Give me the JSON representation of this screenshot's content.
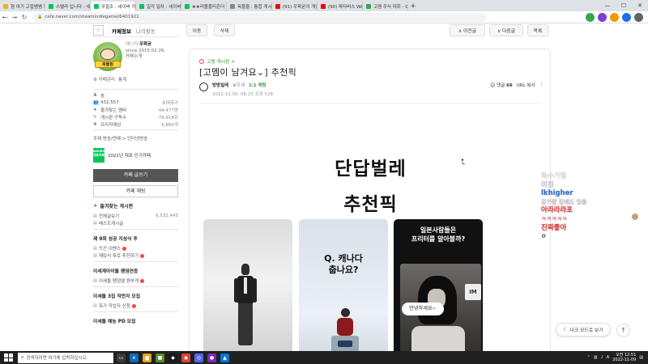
{
  "browser": {
    "tabs": [
      {
        "label": "형 여기 고컬쌤쌤 목블림",
        "color": "#f4b400"
      },
      {
        "label": "스텔라 입니다 : 네이버 카페",
        "color": "#03c75a"
      },
      {
        "label": "우질조 : 네이버 카페",
        "color": "#03c75a"
      },
      {
        "label": "일각 일차 : 네이버 카페",
        "color": "#03c75a"
      },
      {
        "label": "★★러블블리즌더 고려합",
        "color": "#03c75a"
      },
      {
        "label": "옥블블 : 통합 게시판 소개",
        "color": "#888888"
      },
      {
        "label": "(91) 우왁굳의 게임 - YouTube",
        "color": "#ff0000"
      },
      {
        "label": "(90) 왁타버스 WAKTAVERSE",
        "color": "#ff0000"
      },
      {
        "label": "고멤 주식 대회 - Google",
        "color": "#34a853"
      }
    ],
    "active_tab": 2,
    "new_tab": "+",
    "url": "cafe.naver.com/steamindiegame/6401921"
  },
  "sidebar": {
    "tab_info": "카페정보",
    "tab_activity": "나의활동",
    "logo_text": "왁물원",
    "manager_label": "매니저",
    "manager_name": "우왁굳",
    "since": "since 2015.02.26.",
    "cafe_intro": "카페소개",
    "links": [
      "⚙ 카페관리",
      "통계"
    ],
    "level": "숲",
    "members": "432,557",
    "invite": "초대하기",
    "stats": [
      {
        "icon": "★",
        "label": "즐겨찾는 멤버",
        "value": "44,477명"
      },
      {
        "icon": "✎",
        "label": "게시판 구독수",
        "value": "79,918회"
      },
      {
        "icon": "✚",
        "label": "프리카메임",
        "value": "6,880개"
      }
    ],
    "subject": "주제  방송/연예 > 인터넷방송",
    "naver_badge": "NAVER 대표카페",
    "naver_badge_text": "2021년 대표 인기카페",
    "write_button": "카페 글쓰기",
    "chat_button": "카페 채팅",
    "fav_section": "즐겨찾는 게시판",
    "fav_items": [
      {
        "label": "전체글보기",
        "count": "6,532,445"
      },
      {
        "label": "베스트게시글",
        "count": ""
      }
    ],
    "group1": "제 9회 성공 지성식 후",
    "group1_items": [
      "뜨끈 이벤스",
      "재밌식 후로 추천하기"
    ],
    "group2": "이세계아이돌 팬덤연응",
    "group2_items": [
      "이세돌 팬덤엘 원부게"
    ],
    "group3": "이세돌 3집 작먼자 모집",
    "group3_items": [
      "축가 작업자 신청"
    ],
    "group4": "이세돌 예능 PD 모집"
  },
  "toolbar": {
    "move": "이동",
    "delete": "삭제",
    "prev": "∧ 이전글",
    "next": "∨ 다음글",
    "list": "목록"
  },
  "article": {
    "board": "고멤 게시판 >",
    "title": "[고멤이 남겨요⌄] 추천픽",
    "nickname": "방방빌레",
    "grade": "♛우새",
    "chat": "1:1 채팅",
    "meta": "2022.11.09. 08:25  조회 528",
    "comment_label": "댓글",
    "comment_count": "66",
    "url_copy": "URL 복사",
    "more": "⋮",
    "big_line1": "단답벌레",
    "big_line2": "추천픽",
    "thumb2_caption": "Q. 캐나다\n춥나요?",
    "thumb3_caption": "일본사람들은\n프리터를 알아볼까?",
    "thumb3_bubble": "안녕하세요~",
    "thumb3_sign": "IM"
  },
  "chat_overlay": [
    {
      "text": "목수가떨",
      "color": "#e8e8e8"
    },
    {
      "text": "미친",
      "color": "#d0d0d0"
    },
    {
      "text": "lkhigher",
      "color": "#2a6fd6"
    },
    {
      "text": "강가량 킹에드 잉충",
      "color": "#c8c8c8"
    },
    {
      "text": "아라라라포",
      "color": "#e03a3a"
    },
    {
      "text": "ㅋㅋㅋㅋㅋ",
      "color": "#e88a8a"
    },
    {
      "text": "진짜좋아",
      "color": "#e03a3a"
    },
    {
      "text": "ㅇ",
      "color": "#444444"
    }
  ],
  "floating": {
    "dark_mode": "다크 모드로 보기",
    "top": "⤒"
  },
  "taskbar": {
    "search_placeholder": "검색하려면 여기에 입력하십시오.",
    "time": "오전 12:51",
    "date": "2022-11-09",
    "lang": "A"
  }
}
